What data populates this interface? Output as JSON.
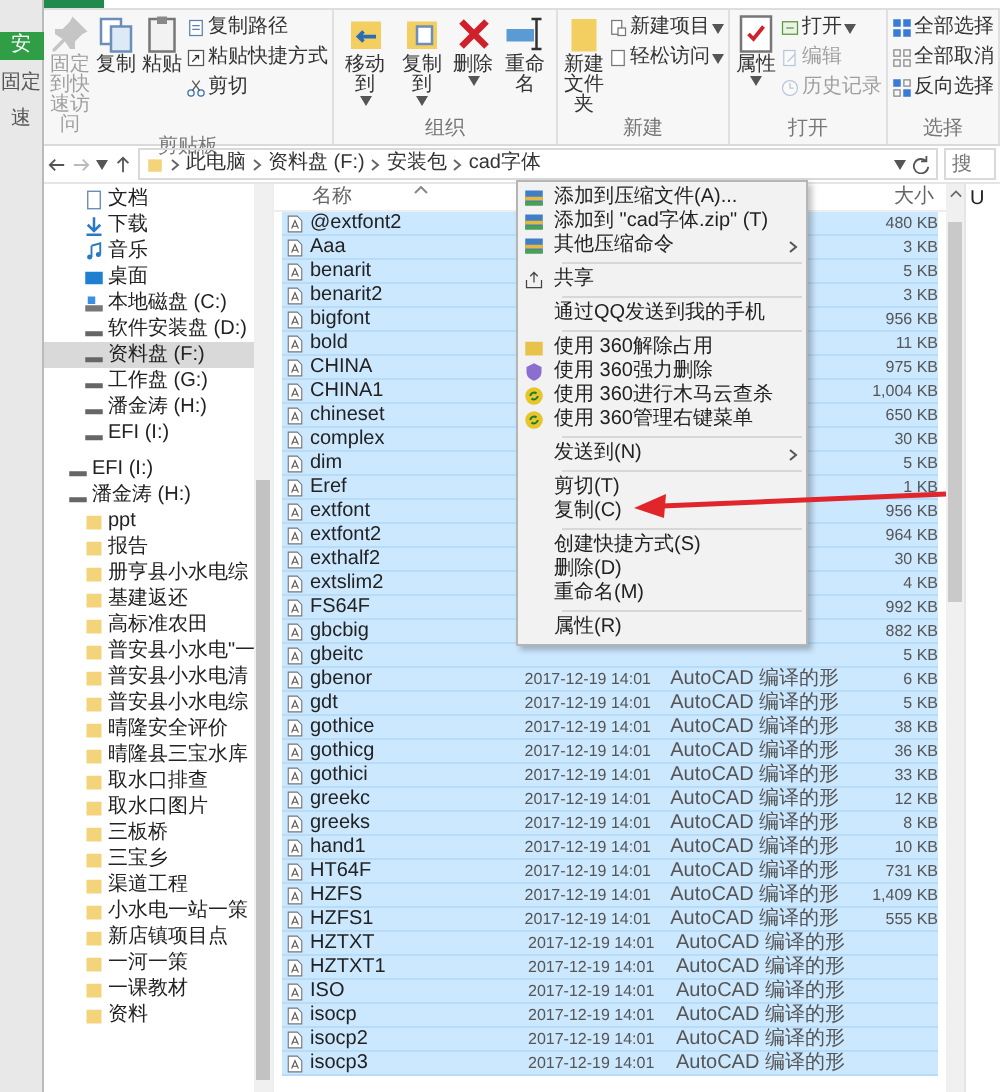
{
  "background_window": {
    "tab_label": "安",
    "texts": [
      "固定",
      "速"
    ]
  },
  "ribbon": {
    "groups": [
      {
        "label": "剪贴板",
        "buttons": [
          {
            "kind": "large",
            "label": "固定到快速访问",
            "disabled": true,
            "dropdown": false
          },
          {
            "kind": "large",
            "label": "复制",
            "disabled": false,
            "dropdown": false
          },
          {
            "kind": "large",
            "label": "粘贴",
            "disabled": false,
            "dropdown": false
          },
          {
            "kind": "small",
            "label": "复制路径",
            "disabled": false,
            "dropdown": false
          },
          {
            "kind": "small",
            "label": "粘贴快捷方式",
            "disabled": false,
            "dropdown": false
          },
          {
            "kind": "small",
            "label": "剪切",
            "disabled": false,
            "dropdown": false
          }
        ]
      },
      {
        "label": "组织",
        "buttons": [
          {
            "kind": "large",
            "label": "移动到",
            "disabled": false,
            "dropdown": true
          },
          {
            "kind": "large",
            "label": "复制到",
            "disabled": false,
            "dropdown": true
          },
          {
            "kind": "large",
            "label": "删除",
            "disabled": false,
            "dropdown": true
          },
          {
            "kind": "large",
            "label": "重命名",
            "disabled": false,
            "dropdown": false
          }
        ]
      },
      {
        "label": "新建",
        "buttons": [
          {
            "kind": "large",
            "label": "新建文件夹",
            "disabled": false,
            "dropdown": false
          },
          {
            "kind": "small",
            "label": "新建项目",
            "disabled": false,
            "dropdown": true
          },
          {
            "kind": "small",
            "label": "轻松访问",
            "disabled": false,
            "dropdown": true
          }
        ]
      },
      {
        "label": "打开",
        "buttons": [
          {
            "kind": "large",
            "label": "属性",
            "disabled": false,
            "dropdown": true
          },
          {
            "kind": "small",
            "label": "打开",
            "disabled": false,
            "dropdown": true
          },
          {
            "kind": "small",
            "label": "编辑",
            "disabled": true,
            "dropdown": false
          },
          {
            "kind": "small",
            "label": "历史记录",
            "disabled": true,
            "dropdown": false
          }
        ]
      },
      {
        "label": "选择",
        "buttons": [
          {
            "kind": "small",
            "label": "全部选择",
            "disabled": false,
            "dropdown": false
          },
          {
            "kind": "small",
            "label": "全部取消",
            "disabled": false,
            "dropdown": false
          },
          {
            "kind": "small",
            "label": "反向选择",
            "disabled": false,
            "dropdown": false
          }
        ]
      }
    ]
  },
  "address_bar": {
    "breadcrumbs": [
      "此电脑",
      "资料盘 (F:)",
      "安装包",
      "cad字体"
    ],
    "search_placeholder": "搜"
  },
  "nav_pane": {
    "this_pc": [
      {
        "label": "文档",
        "selected": false
      },
      {
        "label": "下载",
        "selected": false
      },
      {
        "label": "音乐",
        "selected": false
      },
      {
        "label": "桌面",
        "selected": false
      },
      {
        "label": "本地磁盘 (C:)",
        "selected": false
      },
      {
        "label": "软件安装盘 (D:)",
        "selected": false
      },
      {
        "label": "资料盘 (F:)",
        "selected": true
      },
      {
        "label": "工作盘 (G:)",
        "selected": false
      },
      {
        "label": "潘金涛 (H:)",
        "selected": false
      },
      {
        "label": "EFI (I:)",
        "selected": false
      }
    ],
    "drives": [
      {
        "label": "EFI (I:)",
        "selected": false
      },
      {
        "label": "潘金涛 (H:)",
        "selected": false,
        "children": [
          {
            "label": "ppt",
            "selected": false
          },
          {
            "label": "报告",
            "selected": false
          },
          {
            "label": "册亨县小水电综",
            "selected": false
          },
          {
            "label": "基建返还",
            "selected": false
          },
          {
            "label": "高标准农田",
            "selected": false
          },
          {
            "label": "普安县小水电\"一",
            "selected": false
          },
          {
            "label": "普安县小水电清",
            "selected": false
          },
          {
            "label": "普安县小水电综",
            "selected": false
          },
          {
            "label": "晴隆安全评价",
            "selected": false
          },
          {
            "label": "晴隆县三宝水库",
            "selected": false
          },
          {
            "label": "取水口排查",
            "selected": false
          },
          {
            "label": "取水口图片",
            "selected": false
          },
          {
            "label": "三板桥",
            "selected": false
          },
          {
            "label": "三宝乡",
            "selected": false
          },
          {
            "label": "渠道工程",
            "selected": false
          },
          {
            "label": "小水电一站一策",
            "selected": false
          },
          {
            "label": "新店镇项目点",
            "selected": false
          },
          {
            "label": "一河一策",
            "selected": false
          },
          {
            "label": "一课教材",
            "selected": false
          },
          {
            "label": "资料",
            "selected": false
          }
        ]
      }
    ]
  },
  "file_list": {
    "columns": [
      {
        "kind": "name",
        "label": "名称"
      },
      {
        "kind": "size",
        "label": "大小"
      }
    ],
    "rows": [
      {
        "name": "@extfont2",
        "size": "480 KB",
        "selected": true
      },
      {
        "name": "Aaa",
        "size": "3 KB",
        "selected": true
      },
      {
        "name": "benarit",
        "size": "5 KB",
        "selected": true
      },
      {
        "name": "benarit2",
        "size": "3 KB",
        "selected": true
      },
      {
        "name": "bigfont",
        "size": "956 KB",
        "selected": true
      },
      {
        "name": "bold",
        "size": "11 KB",
        "selected": true
      },
      {
        "name": "CHINA",
        "size": "975 KB",
        "selected": true
      },
      {
        "name": "CHINA1",
        "size": "1,004 KB",
        "selected": true
      },
      {
        "name": "chineset",
        "size": "650 KB",
        "selected": true
      },
      {
        "name": "complex",
        "size": "30 KB",
        "selected": true
      },
      {
        "name": "dim",
        "size": "5 KB",
        "selected": true
      },
      {
        "name": "Eref",
        "size": "1 KB",
        "selected": true
      },
      {
        "name": "extfont",
        "size": "956 KB",
        "selected": true
      },
      {
        "name": "extfont2",
        "size": "964 KB",
        "selected": true
      },
      {
        "name": "exthalf2",
        "size": "30 KB",
        "selected": true
      },
      {
        "name": "extslim2",
        "size": "4 KB",
        "selected": true
      },
      {
        "name": "FS64F",
        "size": "992 KB",
        "selected": true
      },
      {
        "name": "gbcbig",
        "size": "882 KB",
        "selected": true
      },
      {
        "name": "gbeitc",
        "size": "5 KB",
        "selected": true
      },
      {
        "name": "gbenor",
        "date": "2017-12-19 14:01",
        "type": "AutoCAD 编译的形",
        "size": "6 KB",
        "selected": true
      },
      {
        "name": "gdt",
        "date": "2017-12-19 14:01",
        "type": "AutoCAD 编译的形",
        "size": "5 KB",
        "selected": true
      },
      {
        "name": "gothice",
        "date": "2017-12-19 14:01",
        "type": "AutoCAD 编译的形",
        "size": "38 KB",
        "selected": true
      },
      {
        "name": "gothicg",
        "date": "2017-12-19 14:01",
        "type": "AutoCAD 编译的形",
        "size": "36 KB",
        "selected": true
      },
      {
        "name": "gothici",
        "date": "2017-12-19 14:01",
        "type": "AutoCAD 编译的形",
        "size": "33 KB",
        "selected": true
      },
      {
        "name": "greekc",
        "date": "2017-12-19 14:01",
        "type": "AutoCAD 编译的形",
        "size": "12 KB",
        "selected": true
      },
      {
        "name": "greeks",
        "date": "2017-12-19 14:01",
        "type": "AutoCAD 编译的形",
        "size": "8 KB",
        "selected": true
      },
      {
        "name": "hand1",
        "date": "2017-12-19 14:01",
        "type": "AutoCAD 编译的形",
        "size": "10 KB",
        "selected": true
      },
      {
        "name": "HT64F",
        "date": "2017-12-19 14:01",
        "type": "AutoCAD 编译的形",
        "size": "731 KB",
        "selected": true
      },
      {
        "name": "HZFS",
        "date": "2017-12-19 14:01",
        "type": "AutoCAD 编译的形",
        "size": "1,409 KB",
        "selected": true
      },
      {
        "name": "HZFS1",
        "date": "2017-12-19 14:01",
        "type": "AutoCAD 编译的形",
        "size": "555 KB",
        "selected": true
      },
      {
        "name": "HZTXT",
        "date": "2017-12-19 14:01",
        "type": "AutoCAD 编译的形",
        "selected": true
      },
      {
        "name": "HZTXT1",
        "date": "2017-12-19 14:01",
        "type": "AutoCAD 编译的形",
        "selected": true
      },
      {
        "name": "ISO",
        "date": "2017-12-19 14:01",
        "type": "AutoCAD 编译的形",
        "selected": true
      },
      {
        "name": "isocp",
        "date": "2017-12-19 14:01",
        "type": "AutoCAD 编译的形",
        "selected": true
      },
      {
        "name": "isocp2",
        "date": "2017-12-19 14:01",
        "type": "AutoCAD 编译的形",
        "selected": true
      },
      {
        "name": "isocp3",
        "date": "2017-12-19 14:01",
        "type": "AutoCAD 编译的形",
        "selected": true
      }
    ]
  },
  "context_menu": {
    "items": [
      {
        "kind": "item",
        "label": "添加到压缩文件(A)...",
        "submenu": false
      },
      {
        "kind": "item",
        "label": "添加到 \"cad字体.zip\" (T)",
        "submenu": false
      },
      {
        "kind": "item",
        "label": "其他压缩命令",
        "submenu": true
      },
      {
        "kind": "separator"
      },
      {
        "kind": "item",
        "label": "共享",
        "submenu": false
      },
      {
        "kind": "separator"
      },
      {
        "kind": "item",
        "label": "通过QQ发送到我的手机",
        "submenu": false
      },
      {
        "kind": "separator"
      },
      {
        "kind": "item",
        "label": "使用 360解除占用",
        "submenu": false
      },
      {
        "kind": "item",
        "label": "使用 360强力删除",
        "submenu": false
      },
      {
        "kind": "item",
        "label": "使用 360进行木马云查杀",
        "submenu": false
      },
      {
        "kind": "item",
        "label": "使用 360管理右键菜单",
        "submenu": false
      },
      {
        "kind": "separator"
      },
      {
        "kind": "item",
        "label": "发送到(N)",
        "submenu": true
      },
      {
        "kind": "separator"
      },
      {
        "kind": "item",
        "label": "剪切(T)",
        "submenu": false
      },
      {
        "kind": "item",
        "label": "复制(C)",
        "submenu": false
      },
      {
        "kind": "separator"
      },
      {
        "kind": "item",
        "label": "创建快捷方式(S)",
        "submenu": false
      },
      {
        "kind": "item",
        "label": "删除(D)",
        "submenu": false
      },
      {
        "kind": "item",
        "label": "重命名(M)",
        "submenu": false
      },
      {
        "kind": "separator"
      },
      {
        "kind": "item",
        "label": "属性(R)",
        "submenu": false
      }
    ]
  },
  "details_pane": {
    "text": "U"
  }
}
